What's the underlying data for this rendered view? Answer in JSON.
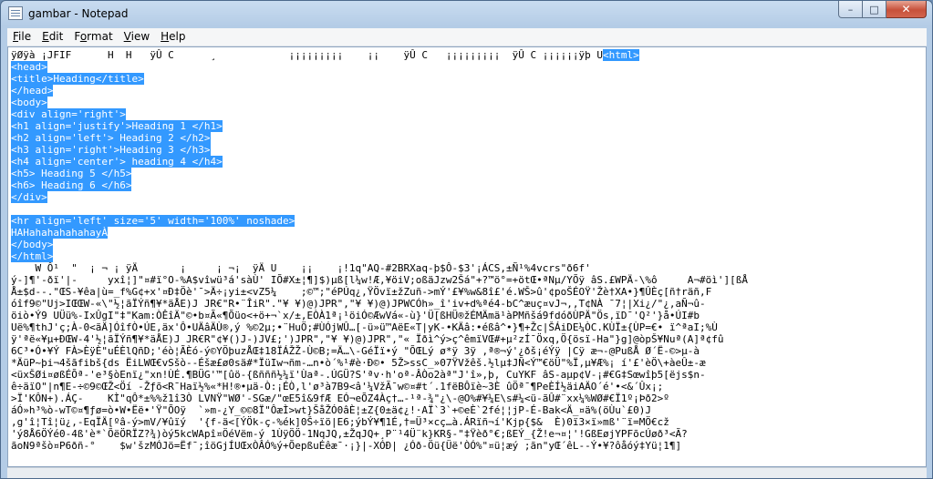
{
  "window": {
    "title": "gambar - Notepad",
    "minimize_glyph": "–",
    "maximize_glyph": "□",
    "close_glyph": "✕"
  },
  "menu": {
    "items": [
      {
        "label": "File",
        "accel": "F",
        "rest": "ile"
      },
      {
        "label": "Edit",
        "accel": "E",
        "rest": "dit"
      },
      {
        "label": "Format",
        "accel": "o",
        "pre": "F",
        "rest": "rmat"
      },
      {
        "label": "View",
        "accel": "V",
        "rest": "iew"
      },
      {
        "label": "Help",
        "accel": "H",
        "rest": "elp"
      }
    ]
  },
  "editor": {
    "lines": [
      {
        "pre": "ÿØÿà ¡JFIF      H  H   ÿÛ C      ¸            ¡¡¡¡¡¡¡¡¡    ¡¡    ÿÛ C   ¡¡¡¡¡¡¡¡¡  ÿÛ C ¡¡¡¡¡¡ÿþ U",
        "sel": "<html>",
        "post": ""
      },
      {
        "pre": "",
        "sel": "<head>",
        "post": ""
      },
      {
        "pre": "",
        "sel": "<title>Heading</title>",
        "post": ""
      },
      {
        "pre": "",
        "sel": "</head>",
        "post": ""
      },
      {
        "pre": "",
        "sel": "<body>",
        "post": ""
      },
      {
        "pre": "",
        "sel": "<div align='right'>",
        "post": ""
      },
      {
        "pre": "",
        "sel": "<h1 align='justify'>Heading 1 </h1>",
        "post": ""
      },
      {
        "pre": "",
        "sel": "<h2 align='left'> Heading 2 </h2>",
        "post": ""
      },
      {
        "pre": "",
        "sel": "<h3 align='right'>Heading 3 </h3>",
        "post": ""
      },
      {
        "pre": "",
        "sel": "<h4 align='center'> heading 4 </h4>",
        "post": ""
      },
      {
        "pre": "",
        "sel": "<h5> Heading 5 </h5>",
        "post": ""
      },
      {
        "pre": "",
        "sel": "<h6> Heading 6 </h6>",
        "post": ""
      },
      {
        "pre": "",
        "sel": "</div>",
        "post": ""
      },
      {
        "pre": "",
        "sel": "",
        "post": ""
      },
      {
        "pre": "",
        "sel": "<hr align='left' size='5' width='100%' noshade>",
        "post": ""
      },
      {
        "pre": "",
        "sel": "HAHahahahahahayÀ",
        "post": ""
      },
      {
        "pre": "",
        "sel": "</body>",
        "post": ""
      },
      {
        "pre": "",
        "sel": "</html>",
        "post": ""
      },
      {
        "pre": "",
        "sel": "",
        "post": "    W Ô¹  \"  ¡ ¬ ¡ ÿÄ       ¡     ¡ ¬¡  ÿÄ U    ¡¡    ¡!1q\"AQ-#2BRXaq-þ$Ô-$3'¡ÁCS,±Ñ¹%4vcrs\"ð6f'"
      },
      {
        "pre": "",
        "sel": "",
        "post": "ý-]¶'-ðï'|-     yxî¦]\"¤#ï°O-%A$vîwü³á'sàÙ' IÕ#X±¦¶]$)µß[l¼w!Æ,¥öiV;oßäJzw2Šá\"+?™ö°=+ötŒ•ªNµ/YÕÿ âS.£WPÄ-\\%ô     A¬#öì'][ßÅ"
      },
      {
        "pre": "",
        "sel": "",
        "post": "Å±$d--.\"ŒS-¥êa|ù=_f%G¢+x'¤Ð‡Öè'¯>Ä÷¡yi±<vZ5¼    ;©™;\"éPÚq¿,ŸÖvï±žZuñ->mÝ'£¥%w&8î£'é.WŠ>û'¢poŠÉOŸ'Žè†XA•}¶ÛÈç[ñ†räñ,F"
      },
      {
        "pre": "",
        "sel": "",
        "post": "óîf9©\"Uj>IŒŒW-«\\\"½¦ãÏÝñ¶¥*äÅE)J JR€\"R•¨ÎiR\".\"¥ ¥)@)JPR\",\"¥ ¥)@)JPWCÓh»_î'iv+d%ªé4-bC^æuç¤vJ¬,,T¢NÀ ¯7¦|Xi¿/\"¿,aÑ¬û-"
      },
      {
        "pre": "",
        "sel": "",
        "post": "öiò•Ý9 UÜü%-IxÛgI\"‡\"Kam:ÒÊîÄ\"©•b¤Ã«¶Õüo<+ö+¬`x/±,EÒÀ1ª¡¹öiÓ©ÆwVá«-ù}'Ü[ßHÜ®žÉMÄmä¹àPMñšá9fdóðÙPÄ\"Ös,ïD¯'Q²'}å•ÚI#b"
      },
      {
        "pre": "",
        "sel": "",
        "post": "Uë%¶thJ'ç;À-0<ãÄ]ÓîfÒ•ÚE,äx'Ô•UÄâÄÙ®,ý %©2µ;•¨HuÖ;#ÙÓjWÛ…[-ü»ü™AëE«T|yK-•KÄâ:•éßâ^•}¶+Žc|ŠÁiDE¼ÒC.KÙÏ±{ÙP=€• ï^ªaI;%Ù"
      },
      {
        "pre": "",
        "sel": "",
        "post": "ÿ'ªë«¥µ+ÐŒW-4'½¦ãÏÝñ¶¥*äÅE)J JR€R\"¢¥()J-)JV£;')JPR\",\"¥ ¥)@)JPR\",\"« Ïðì^ý>ç^êmïVŒ#+µ²zÍ¯Öxq,Ö{ösï-Ha\"}g]@òpŠ¥Nuª(A]ª¢fû"
      },
      {
        "pre": "",
        "sel": "",
        "post": "6C³•Ó•¥Ý FÀ>ÈÿÈ\"uÉÈlQñD;'éò¦ÃÈó-ý©YÖþuzÅŒ‡18ÏÁŽŽ-Ù©B;=Ä…\\-GéÏï•ý \"ÕŒLý ø*ÿ 3ÿ ,ª®¬ý'¿ðš¡éÝÿ |Cÿ æ¬-@PußÅ Ø´Ë-©>µ-à"
      },
      {
        "pre": "",
        "sel": "",
        "post": "*ÄüP~þi¬4šãfibš{ds ËiLWŒ€vSšò--Éšæ£ø0sä#*ÏüIw¬ñm-…n•ò´%¹#è·Ð©• 5Ž>ssC_»07ŸVžêš.½lµ‡JÑ<Ý™€öÜ\"%Ï,µ¥Æ%¡ í'£'èÖ\\+àeÛ±-æ"
      },
      {
        "pre": "",
        "sel": "",
        "post": "<üxŠØi¤øßÉÕª-'e³§òEnï¿\"xn!ÙÉ.¶BÜG'™[ûö-{ßñññ½¼ï'Ùaª-.ÚGÜ?S'ªv·h'oª-ÂÒo2àª\"J'î»,þ, CuYKF âS-aµp¢V-¡#€G‡Sœwîþ5[ëjs$n-"
      },
      {
        "pre": "",
        "sel": "",
        "post": "ê÷äïO\"|n¶E-÷©9©ŒŽ<Öí -Žƒõ<R¯Haï½%«*H!®•µä-Ò:¡ÉÒ,l'ø³à7B9<â'¼VžÃ¯w©¤#t´.1fëBÔïè~3È ûÖª¯¶PeÈÍ½äiAÄO´é'•<&´Ûx¡;"
      },
      {
        "pre": "",
        "sel": "",
        "post": ">Ï'KÔN+).ÁÇ-    KÌ\"qÔ*±%%ž1î3Ò LVNŸ\"WØ'-SGæ/\"œE5î&9fÆ EÓ¬eÕZ4Àç†…-¹ª-¾\"¿\\-@O%#¥¼E\\s#¼<ü-ãÛ#¨xx¼%WØ#€Ï1º¡Þð2>º"
      },
      {
        "pre": "",
        "sel": "",
        "post": "áÓ»h³%ò-wT©¤¶ƒø=ò•W•Ëë•'Ÿ\"ÕOÿ  `»m-¿Y_©©8Ï\"ÔæÌ>wt}ŠåŽÓ0âÈ¦±Z{0±ä¢¿!·AÏ`3`+©eÈ`2fé¦¦jP-É-Bak<Ä_¤ä%(öÙu`£0)J"
      },
      {
        "pre": "",
        "sel": "",
        "post": ",g'î¦Tî¦ü¿,-EqÏÄ[ºâ-ý>mV/¥ûïý  '{f-ä<[ÝÖk-ç-%ék]0Š÷ïö|E6;ýbÝ¥¶1É,†=Ü³×cç…à.ÁRïñ¬í'Kjp{$&  È)0ï3×ï»mß'¨ï=MÖ€cž"
      },
      {
        "pre": "",
        "sel": "",
        "post": "'ý8Å6ÖÝé0-4ß'è*`ÕëÖRÏZ?¾)òý5kcWApî¤ÖéVëm-ý 1ÙÿÖÖ-1NqJQ,±ŽqJQ+¸P¨¹4Ü¨k}KR§-\"‡Ÿèð°€;ßEÝ_{Ž!e¬¤¦'!GßEøjYPFõcÚøð³<Ã?"
      },
      {
        "pre": "",
        "sel": "",
        "post": "ãoN9ªšò¤P6ðñ-°    $w'šzMÓJö=Ëf¯;îöGjÍUŒxÒÂÓ%ý+ÕepßuÉêæ¯·¡}|-XÓÐ| ¿Óð-Öü{Üë'ÒÓ%\"¤ü¦æý ;ãn\"yŒ´êL--Ý•¥?ôåóý‡Yü¦1¶]"
      }
    ]
  }
}
